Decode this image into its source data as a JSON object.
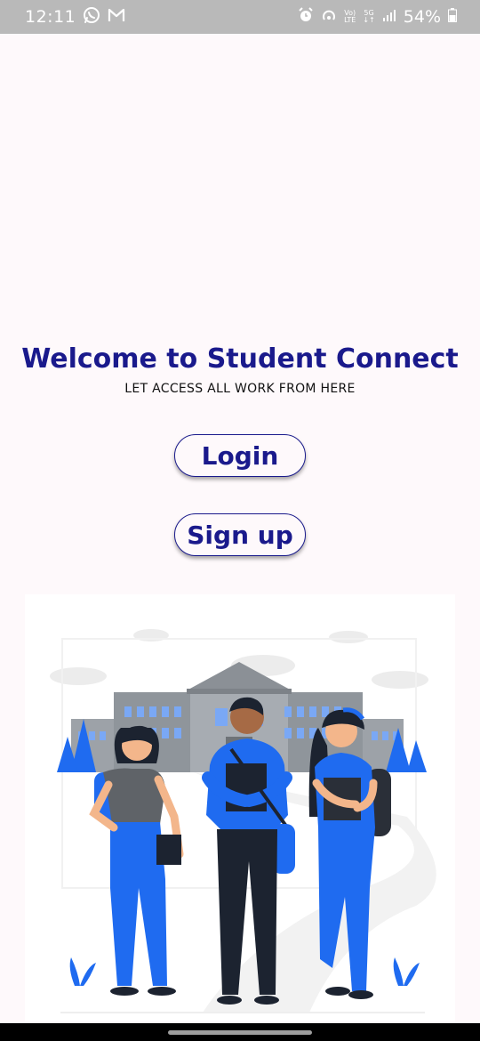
{
  "status_bar": {
    "time": "12:11",
    "battery_percent": "54%",
    "volte_label_top": "Vo)",
    "volte_label_bottom": "LTE",
    "network_label_top": "5G",
    "network_label_bottom": "↓↑",
    "icons": [
      "whatsapp-icon",
      "gmail-icon",
      "alarm-icon",
      "hotspot-icon",
      "volte-icon",
      "5g-icon",
      "signal-icon",
      "battery-icon"
    ]
  },
  "welcome": {
    "title": "Welcome to  Student Connect",
    "subtitle": "LET ACCESS ALL WORK FROM HERE"
  },
  "buttons": {
    "login_label": "Login",
    "signup_label": "Sign up"
  },
  "colors": {
    "accent": "#1a1a8c",
    "background": "#fef9fb",
    "illustration_blue": "#1f6bf0"
  }
}
